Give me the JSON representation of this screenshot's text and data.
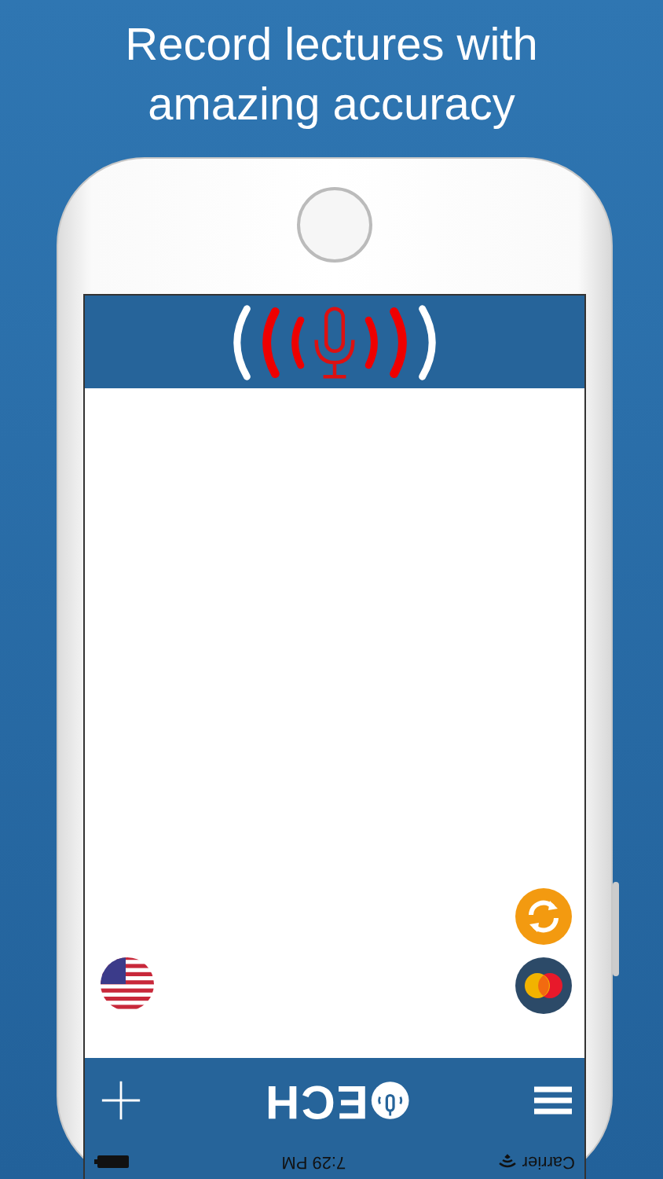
{
  "headline": "Record lectures with amazing accuracy",
  "app": {
    "logo_text": "ECH",
    "status_bar": {
      "carrier": "Carrier",
      "time": "7:29 PM"
    }
  }
}
